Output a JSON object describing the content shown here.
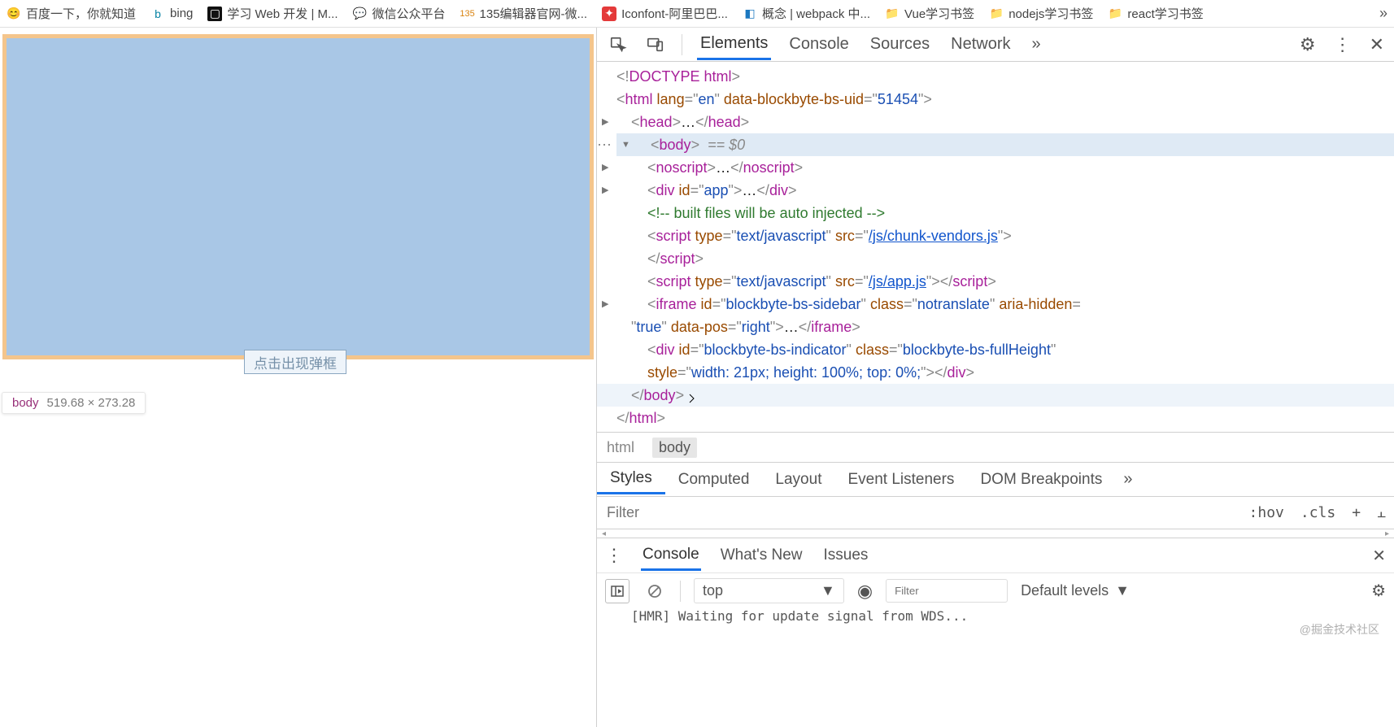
{
  "bookmarks": [
    {
      "label": "百度一下，你就知道",
      "icon_color": "#2e66d2"
    },
    {
      "label": "bing",
      "icon_color": "#0a84a5"
    },
    {
      "label": "学习 Web 开发 | M...",
      "icon_color": "#111"
    },
    {
      "label": "微信公众平台",
      "icon_color": "#1aad19"
    },
    {
      "label": "135编辑器官网-微...",
      "icon_color": "#d98310"
    },
    {
      "label": "Iconfont-阿里巴巴...",
      "icon_color": "#e43a3a"
    },
    {
      "label": "概念 | webpack 中...",
      "icon_color": "#1c78c0"
    },
    {
      "label": "Vue学习书签",
      "icon_color": "#f1c24c"
    },
    {
      "label": "nodejs学习书签",
      "icon_color": "#f1c24c"
    },
    {
      "label": "react学习书签",
      "icon_color": "#f1c24c"
    }
  ],
  "page": {
    "button_label": "点击出现弹框",
    "tip_tag": "body",
    "tip_dim": "519.68 × 273.28"
  },
  "devtools": {
    "tabs": [
      "Elements",
      "Console",
      "Sources",
      "Network"
    ],
    "active_tab": "Elements",
    "overflow_glyph": "»"
  },
  "dom": {
    "doctype": "<!DOCTYPE html>",
    "html_open": {
      "lang": "en",
      "uid_attr": "data-blockbyte-bs-uid",
      "uid_val": "51454"
    },
    "head_ellipsis": "…",
    "body_eq": "== $0",
    "noscript_ellipsis": "…",
    "app_ellipsis": "…",
    "comment": "built files will be auto injected",
    "script1_type": "text/javascript",
    "script1_src": "/js/chunk-vendors.js",
    "script2_type": "text/javascript",
    "script2_src": "/js/app.js",
    "iframe_id": "blockbyte-bs-sidebar",
    "iframe_class": "notranslate",
    "iframe_hidden_attr": "aria-hidden",
    "iframe_hidden_val": "true",
    "iframe_pos_attr": "data-pos",
    "iframe_pos_val": "right",
    "iframe_ellipsis": "…",
    "indicator_id": "blockbyte-bs-indicator",
    "indicator_class": "blockbyte-bs-fullHeight",
    "indicator_style": "width: 21px; height: 100%; top: 0%;"
  },
  "breadcrumbs": [
    "html",
    "body"
  ],
  "styles": {
    "tabs": [
      "Styles",
      "Computed",
      "Layout",
      "Event Listeners",
      "DOM Breakpoints"
    ],
    "active": "Styles",
    "filter_placeholder": "Filter",
    "toggles": [
      ":hov",
      ".cls",
      "+",
      "⫠"
    ]
  },
  "drawer": {
    "tabs": [
      "Console",
      "What's New",
      "Issues"
    ],
    "active": "Console",
    "scope": "top",
    "filter_placeholder": "Filter",
    "levels": "Default levels",
    "log_fragment": "[HMR] Waiting for update signal from WDS..."
  },
  "watermark": "@掘金技术社区"
}
